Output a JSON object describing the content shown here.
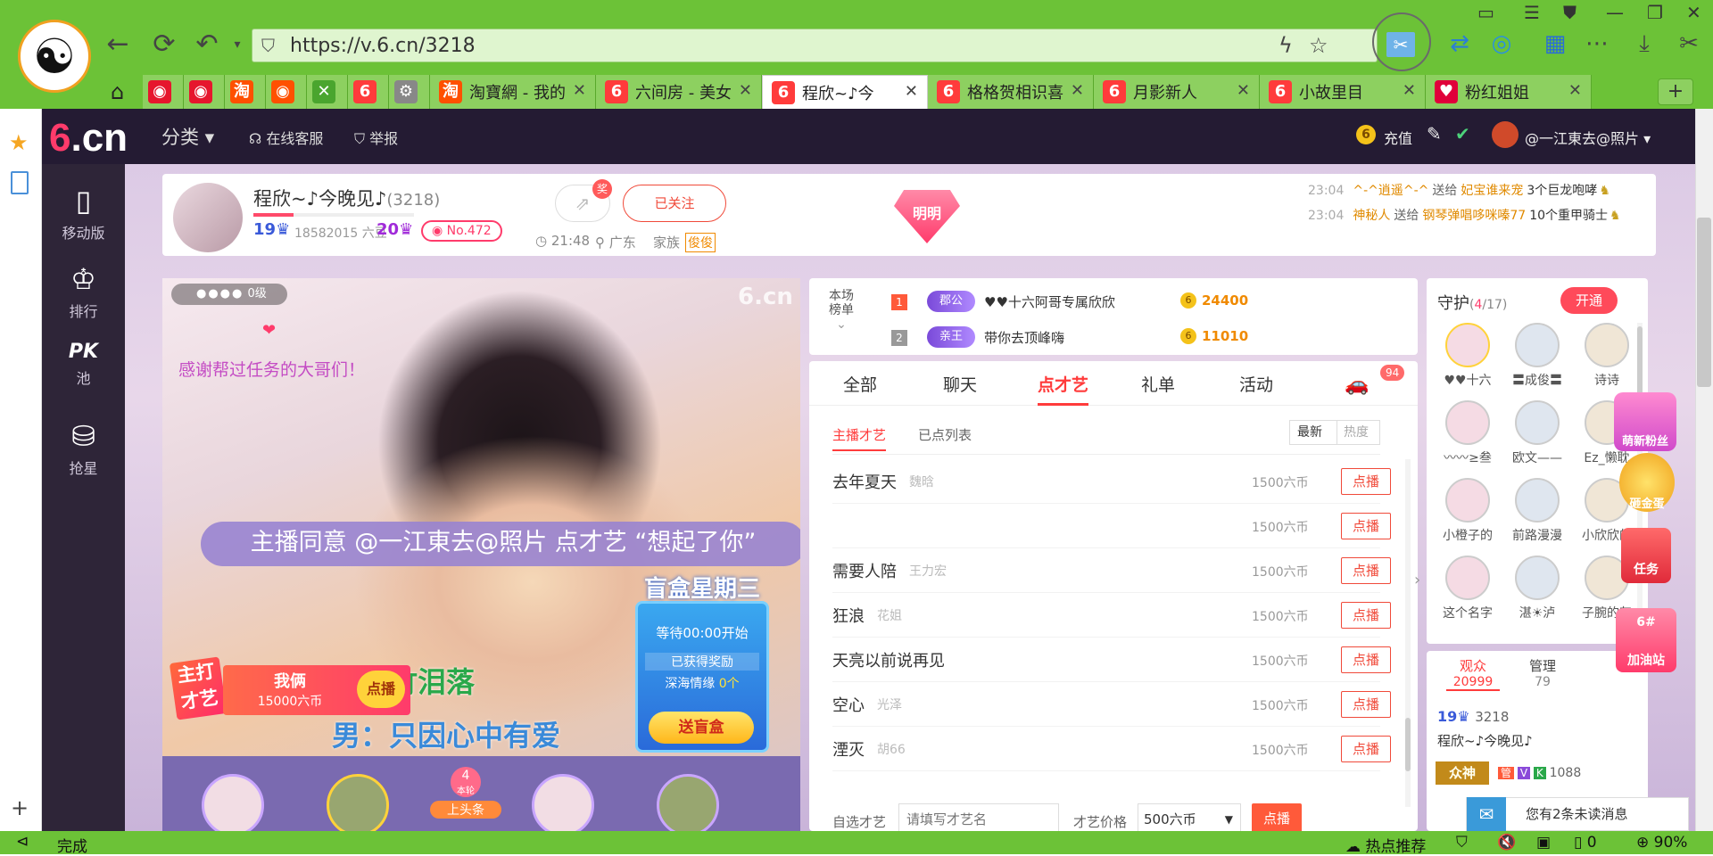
{
  "browser": {
    "url": "https://v.6.cn/3218",
    "tabs": [
      {
        "label": "",
        "icon": "weibo-icon",
        "color": "#e6162d"
      },
      {
        "label": "",
        "icon": "weibo-icon",
        "color": "#e6162d"
      },
      {
        "label": "",
        "icon": "taobao-icon",
        "color": "#ff5000"
      },
      {
        "label": "",
        "icon": "tmall-icon",
        "color": "#ff5000"
      },
      {
        "label": "",
        "icon": "x-icon",
        "color": "#4aa52e"
      },
      {
        "label": "",
        "icon": "6cn-icon",
        "color": "#ff3b3b"
      },
      {
        "label": "",
        "icon": "gear-icon",
        "color": "#888888"
      },
      {
        "label": "淘寶網 - 我的",
        "icon": "taobao-icon",
        "color": "#ff5000"
      },
      {
        "label": "六间房 - 美女",
        "icon": "6cn-icon",
        "color": "#ff3b3b"
      },
      {
        "label": "程欣~♪今",
        "icon": "6cn-icon",
        "color": "#ff3b3b",
        "active": true
      },
      {
        "label": "格格贺相识喜",
        "icon": "6cn-icon",
        "color": "#ff3b3b"
      },
      {
        "label": "月影新人",
        "icon": "6cn-icon",
        "color": "#ff3b3b"
      },
      {
        "label": "小故里目",
        "icon": "6cn-icon",
        "color": "#ff3b3b"
      },
      {
        "label": "粉红姐姐",
        "icon": "lips-icon",
        "color": "#e0003a"
      }
    ],
    "status": {
      "left": "完成",
      "hot": "热点推荐",
      "count": "0",
      "zoom": "90%"
    }
  },
  "topnav": {
    "category": "分类",
    "service": "在线客服",
    "report": "举报",
    "recharge": "充值",
    "user": "@一江東去@照片"
  },
  "sidebar": [
    {
      "label": "移动版",
      "icon": "phone-icon"
    },
    {
      "label": "排行",
      "icon": "crown-icon"
    },
    {
      "label": "池",
      "icon": "pk-icon",
      "top": "PK"
    },
    {
      "label": "抢星",
      "icon": "star-bag-icon"
    }
  ],
  "header": {
    "name": "程欣~♪今晚见♪",
    "roomid": "(3218)",
    "level1": "19",
    "beans": "18582015 六豆",
    "level2": "20",
    "rank": "No.472",
    "follow": "已关注",
    "time": "21:48",
    "region": "广东",
    "family_label": "家族",
    "family": "俊俊",
    "badge": "明明",
    "gift_badge": "奖",
    "feed": [
      {
        "time": "23:04",
        "from": "^-^逍遥^-^",
        "verb": "送给",
        "to": "妃宝谁来宠",
        "gift": "3个巨龙咆哮"
      },
      {
        "time": "23:04",
        "from": "神秘人",
        "verb": "送给",
        "to": "钢琴弹唱哆咪嗪77",
        "gift": "10个重甲骑士"
      }
    ]
  },
  "video": {
    "level": "0级",
    "thanks": "感谢帮过任务的大哥们！",
    "lyric1": "雨去竹泪落",
    "lyric2": "男：只因心中有爱",
    "banner": "主播同意 @一江東去@照片 点才艺 “想起了你”",
    "talent_tag1": "主打",
    "talent_tag2": "才艺",
    "talent_name": "我俩",
    "talent_price": "15000六币",
    "talent_btn": "点播",
    "box_title": "盲盒星期三",
    "box_wait": "等待00:00开始",
    "box_got": "已获得奖励",
    "box_item": "深海情缘",
    "box_count": "0个",
    "box_btn": "送盲盒",
    "bottom_round": "4",
    "bottom_round_label": "本轮",
    "bottom_head": "上头条"
  },
  "rank": {
    "label1": "本场",
    "label2": "榜单",
    "rows": [
      {
        "no": "1",
        "title": "郡公",
        "name": "♥♥十六阿哥专属欣欣",
        "score": "24400"
      },
      {
        "no": "2",
        "title": "亲王",
        "name": "带你去顶峰嗨",
        "score": "11010"
      }
    ]
  },
  "talent": {
    "tabs": [
      "全部",
      "聊天",
      "点才艺",
      "礼单",
      "活动"
    ],
    "car_count": "94",
    "subtabs": [
      "主播才艺",
      "已点列表"
    ],
    "sort": [
      "最新",
      "热度"
    ],
    "rows": [
      {
        "song": "去年夏天",
        "artist": "魏晗",
        "price": "1500六币"
      },
      {
        "song": "",
        "artist": "",
        "price": "1500六币"
      },
      {
        "song": "需要人陪",
        "artist": "王力宏",
        "price": "1500六币"
      },
      {
        "song": "狂浪",
        "artist": "花姐",
        "price": "1500六币"
      },
      {
        "song": "天亮以前说再见",
        "artist": "",
        "price": "1500六币"
      },
      {
        "song": "空心",
        "artist": "光泽",
        "price": "1500六币"
      },
      {
        "song": "湮灭",
        "artist": "胡66",
        "price": "1500六币"
      }
    ],
    "row_btn": "点播",
    "custom_label": "自选才艺",
    "custom_placeholder": "请填写才艺名",
    "price_label": "才艺价格",
    "price_value": "500六币",
    "custom_btn": "点播"
  },
  "guard": {
    "title": "守护",
    "count": "4",
    "total": "/17",
    "open": "开通",
    "members": [
      "♥♥十六",
      "〓成俊〓",
      "诗诗",
      "〰〰≥叁",
      "欧文——",
      "Ez_懒耽",
      "小橙子的",
      "前路漫漫",
      "小欣欣的",
      "这个名字",
      "湛☀泸",
      "子腕的灰"
    ]
  },
  "audience": {
    "tab1": "观众",
    "tab1_count": "20999",
    "tab2": "管理",
    "tab2_count": "79",
    "level": "19",
    "id": "3218",
    "name": "程欣~♪今晚见♪",
    "id2": "1088"
  },
  "floating": {
    "new_fans": "萌新粉丝",
    "gold_egg": "砸金蛋",
    "task": "任务",
    "fuel_no": "6#",
    "fuel": "加油站",
    "msg": "您有2条未读消息"
  }
}
